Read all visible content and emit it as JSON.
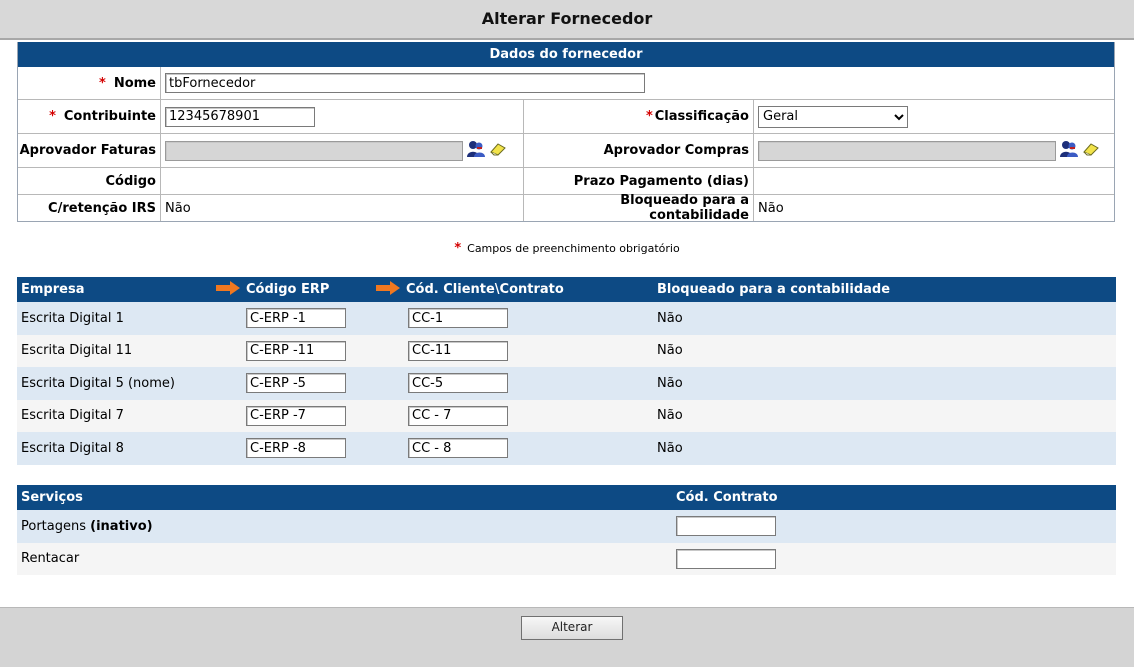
{
  "page_title": "Alterar Fornecedor",
  "supplier_section": {
    "heading": "Dados do fornecedor",
    "nome_label": "Nome",
    "nome_value": "tbFornecedor",
    "contribuinte_label": "Contribuinte",
    "contribuinte_value": "12345678901",
    "classificacao_label": "Classificação",
    "classificacao_value": "Geral",
    "aprovador_faturas_label": "Aprovador Faturas",
    "aprovador_compras_label": "Aprovador Compras",
    "codigo_label": "Código",
    "codigo_value": "",
    "prazo_label": "Prazo Pagamento (dias)",
    "prazo_value": "",
    "retencao_label": "C/retenção IRS",
    "retencao_value": "Não",
    "bloqueado_label": "Bloqueado para a contabilidade",
    "bloqueado_value": "Não"
  },
  "required_note": "Campos de preenchimento obrigatório",
  "companies_table": {
    "headers": {
      "empresa": "Empresa",
      "codigo_erp": "Código ERP",
      "cod_cliente": "Cód. Cliente\\Contrato",
      "bloqueado": "Bloqueado para a contabilidade"
    },
    "rows": [
      {
        "empresa": "Escrita Digital 1",
        "codigo_erp": "C-ERP -1",
        "cod_cliente": "CC-1",
        "bloqueado": "Não"
      },
      {
        "empresa": "Escrita Digital 11",
        "codigo_erp": "C-ERP -11",
        "cod_cliente": "CC-11",
        "bloqueado": "Não"
      },
      {
        "empresa": "Escrita Digital 5 (nome)",
        "codigo_erp": "C-ERP -5",
        "cod_cliente": "CC-5",
        "bloqueado": "Não"
      },
      {
        "empresa": "Escrita Digital 7",
        "codigo_erp": "C-ERP -7",
        "cod_cliente": "CC - 7",
        "bloqueado": "Não"
      },
      {
        "empresa": "Escrita Digital 8",
        "codigo_erp": "C-ERP -8",
        "cod_cliente": "CC - 8",
        "bloqueado": "Não"
      }
    ]
  },
  "services_table": {
    "headers": {
      "servicos": "Serviços",
      "cod_contrato": "Cód. Contrato"
    },
    "rows": [
      {
        "name": "Portagens",
        "status": "(inativo)",
        "cod_contrato": ""
      },
      {
        "name": "Rentacar",
        "status": "",
        "cod_contrato": ""
      }
    ]
  },
  "submit_label": "Alterar",
  "colors": {
    "header_blue": "#0d4a84",
    "required_red": "#d40000",
    "arrow_orange": "#f07820"
  },
  "icons": {
    "approver_lookup": "users-lookup-icon",
    "approver_clear": "eraser-icon",
    "column_arrow": "arrow-right-icon"
  }
}
